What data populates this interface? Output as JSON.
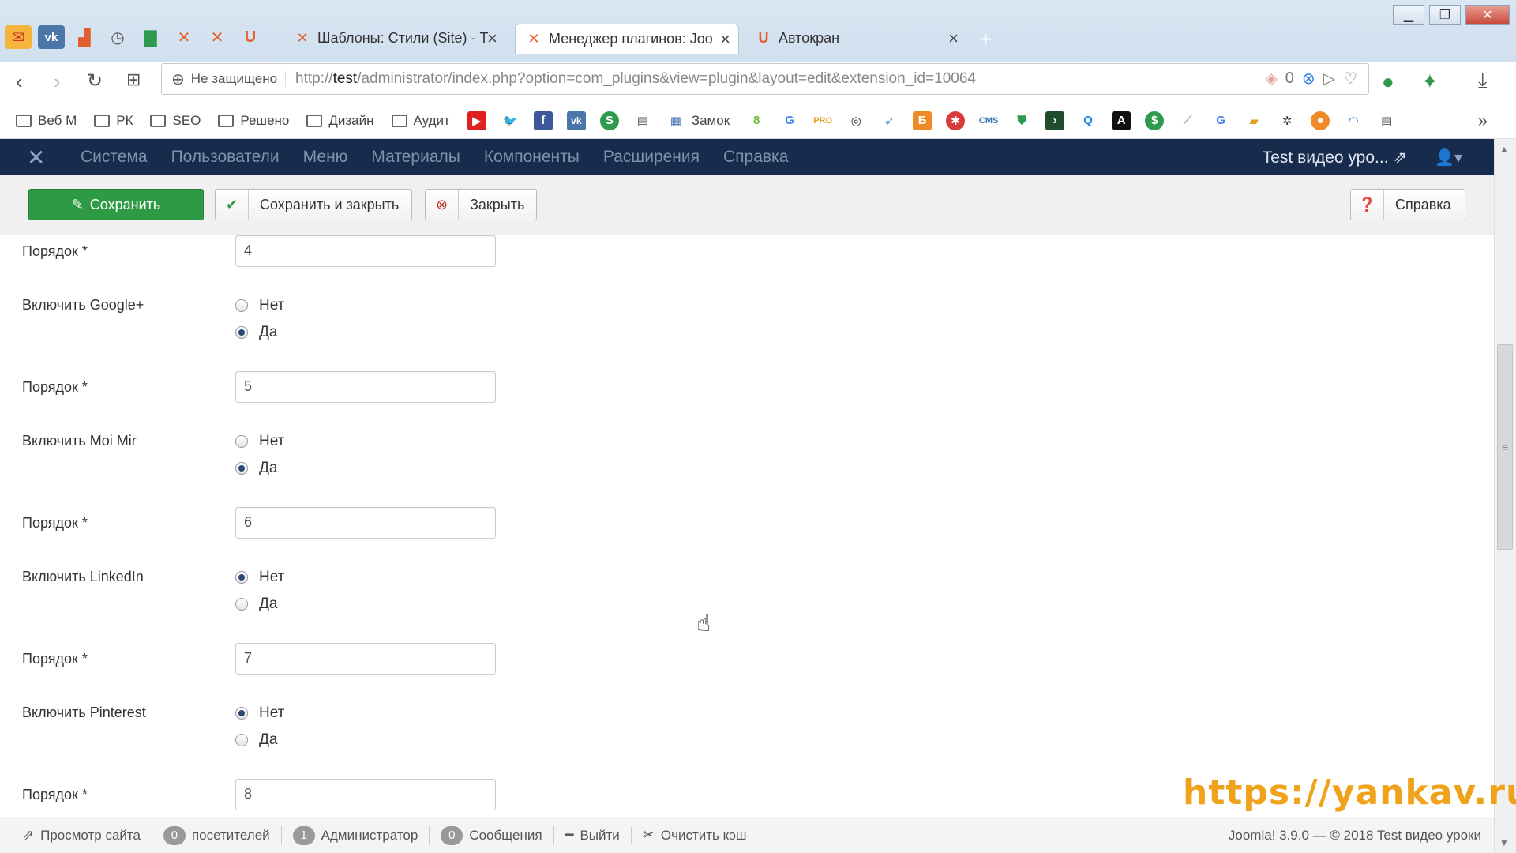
{
  "browser": {
    "tabs": [
      {
        "title": "Шаблоны: Стили (Site) - Т",
        "active": false
      },
      {
        "title": "Менеджер плагинов: Joo",
        "active": true
      },
      {
        "title": "Автокран",
        "active": false
      }
    ],
    "new_tab": "+",
    "insecure_label": "Не защищено",
    "url_prefix": "http://",
    "url_host": "test",
    "url_path": "/administrator/index.php?option=com_plugins&view=plugin&layout=edit&extension_id=10064",
    "url_counter": "0",
    "bookmarks": [
      {
        "label": "Веб М",
        "type": "folder"
      },
      {
        "label": "РК",
        "type": "folder"
      },
      {
        "label": "SEO",
        "type": "folder"
      },
      {
        "label": "Решено",
        "type": "folder"
      },
      {
        "label": "Дизайн",
        "type": "folder"
      },
      {
        "label": "Аудит",
        "type": "folder"
      },
      {
        "label": "Замок",
        "type": "link"
      }
    ],
    "bookmarks_more": "»"
  },
  "joomla": {
    "menu": [
      "Система",
      "Пользователи",
      "Меню",
      "Материалы",
      "Компоненты",
      "Расширения",
      "Справка"
    ],
    "site_name": "Test видео уро...",
    "toolbar": {
      "save": "Сохранить",
      "save_close": "Сохранить и закрыть",
      "close": "Закрыть",
      "help": "Справка"
    },
    "form": {
      "order_label": "Порядок *",
      "no_label": "Нет",
      "yes_label": "Да",
      "orders": [
        "4",
        "5",
        "6",
        "7",
        "8"
      ],
      "toggles": [
        {
          "label": "Включить Google+",
          "value": "Да"
        },
        {
          "label": "Включить Moi Mir",
          "value": "Да"
        },
        {
          "label": "Включить LinkedIn",
          "value": "Нет"
        },
        {
          "label": "Включить Pinterest",
          "value": "Нет"
        }
      ]
    },
    "status": {
      "view_site": "Просмотр сайта",
      "visitors_count": "0",
      "visitors": "посетителей",
      "admins_count": "1",
      "admins": "Администратор",
      "messages_count": "0",
      "messages": "Сообщения",
      "logout": "Выйти",
      "clear_cache": "Очистить кэш",
      "copyright": "Joomla! 3.9.0 — © 2018 Test видео уроки"
    }
  },
  "watermark": "https://yankav.ru",
  "colors": {
    "nav_bg": "#172b4d",
    "save_green": "#2f9a45",
    "watermark": "#f0a21a"
  }
}
